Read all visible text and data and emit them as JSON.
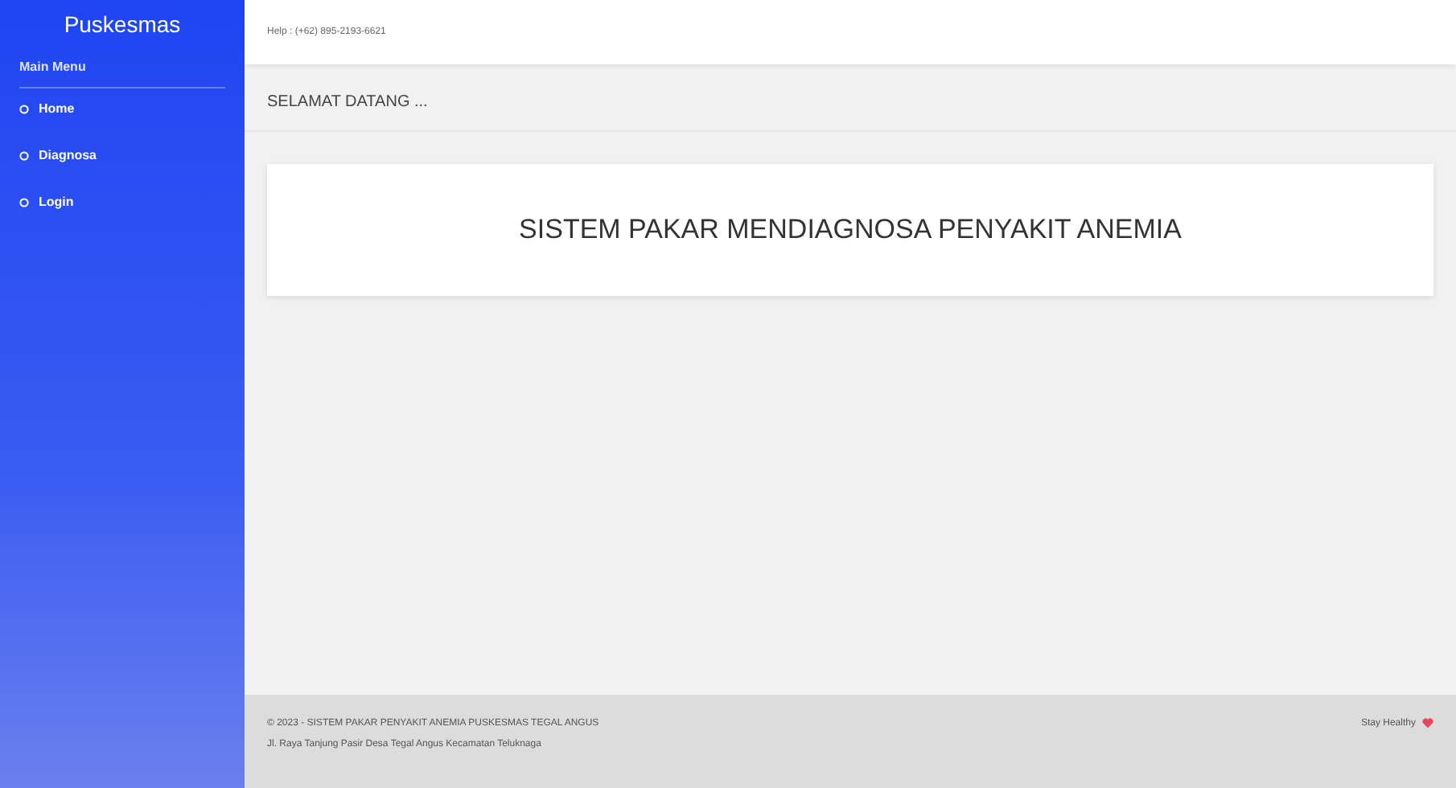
{
  "sidebar": {
    "brand": "Puskesmas",
    "section": "Main Menu",
    "items": [
      {
        "label": "Home"
      },
      {
        "label": "Diagnosa"
      },
      {
        "label": "Login"
      }
    ]
  },
  "topbar": {
    "help": "Help : (+62) 895-2193-6621"
  },
  "page_header": "SELAMAT DATANG ...",
  "banner": "SISTEM PAKAR MENDIAGNOSA PENYAKIT ANEMIA",
  "footer": {
    "copyright": "© 2023 - SISTEM PAKAR PENYAKIT ANEMIA PUSKESMAS TEGAL ANGUS",
    "address": "Jl. Raya Tanjung Pasir Desa Tegal Angus Kecamatan Teluknaga",
    "tagline": "Stay Healthy"
  }
}
